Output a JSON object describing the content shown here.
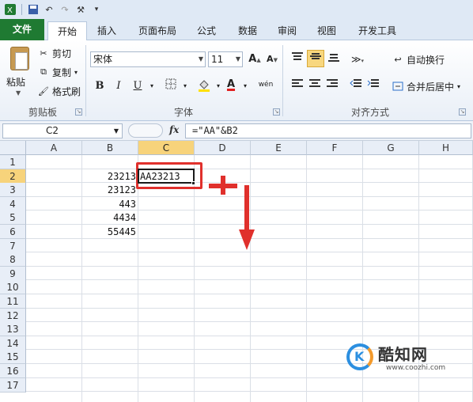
{
  "qat": {
    "items": [
      "excel-logo-icon",
      "save-icon",
      "undo-icon",
      "redo-icon",
      "format-painter-icon",
      "customize-icon"
    ]
  },
  "tabs": [
    {
      "label": "文件",
      "name": "tab-file"
    },
    {
      "label": "开始",
      "name": "tab-home",
      "active": true
    },
    {
      "label": "插入",
      "name": "tab-insert"
    },
    {
      "label": "页面布局",
      "name": "tab-page-layout"
    },
    {
      "label": "公式",
      "name": "tab-formulas"
    },
    {
      "label": "数据",
      "name": "tab-data"
    },
    {
      "label": "审阅",
      "name": "tab-review"
    },
    {
      "label": "视图",
      "name": "tab-view"
    },
    {
      "label": "开发工具",
      "name": "tab-developer"
    }
  ],
  "clipboard": {
    "paste_label": "粘贴",
    "cut_label": "剪切",
    "copy_label": "复制",
    "format_painter_label": "格式刷",
    "group_label": "剪贴板"
  },
  "font": {
    "font_name": "宋体",
    "font_size": "11",
    "bold": "B",
    "italic": "I",
    "underline": "U",
    "grow": "A",
    "shrink": "A",
    "font_color": "A",
    "phonetic": "wén",
    "group_label": "字体"
  },
  "alignment": {
    "wrap_label": "自动换行",
    "merge_label": "合并后居中",
    "group_label": "对齐方式"
  },
  "formula_bar": {
    "name_box": "C2",
    "fx": "fx",
    "formula": "=\"AA\"&B2"
  },
  "sheet": {
    "columns": [
      "A",
      "B",
      "C",
      "D",
      "E",
      "F",
      "G",
      "H"
    ],
    "rows": [
      "1",
      "2",
      "3",
      "4",
      "5",
      "6",
      "7",
      "8",
      "9",
      "10",
      "11",
      "12",
      "13",
      "14",
      "15",
      "16",
      "17"
    ],
    "selected_column": "C",
    "selected_row": "2",
    "column_b_values": [
      "23213",
      "23123",
      "443",
      "4434",
      "55445"
    ],
    "c2_value": "AA23213"
  },
  "watermark": {
    "logo_letter": "K",
    "name": "酷知网",
    "url": "www.coozhi.com"
  },
  "colors": {
    "accent_file_tab": "#1f7a32",
    "selection_header": "#f7d37b",
    "annotation_red": "#e0302c"
  }
}
